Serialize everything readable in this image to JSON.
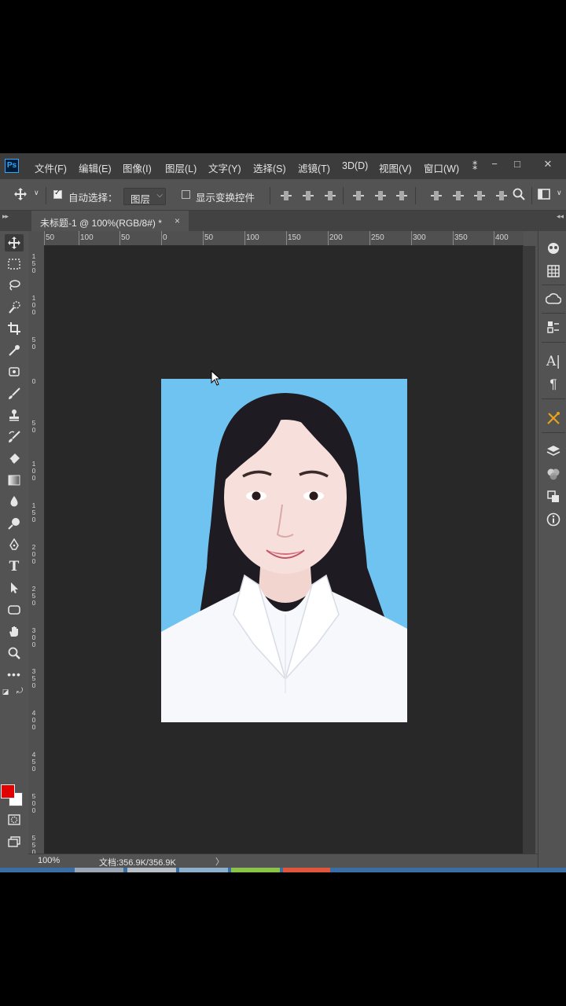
{
  "app": {
    "logo": "Ps",
    "menu": [
      "文件(F)",
      "编辑(E)",
      "图像(I)",
      "图层(L)",
      "文字(Y)",
      "选择(S)",
      "滤镜(T)",
      "3D(D)",
      "视图(V)",
      "窗口(W)"
    ],
    "menu_overflow": "⁑",
    "window_controls": {
      "minimize": "−",
      "restore": "□",
      "close": "✕"
    }
  },
  "options_bar": {
    "auto_select_checked": true,
    "auto_select_label": "自动选择：",
    "target_value": "图层",
    "show_transform_checked": false,
    "show_transform_label": "显示变换控件"
  },
  "document": {
    "tab_title": "未标题-1 @ 100%(RGB/8#) *",
    "tab_close": "×"
  },
  "ruler": {
    "top_labels": [
      "50",
      "100",
      "50",
      "0",
      "50",
      "100",
      "150",
      "200",
      "250",
      "300",
      "350",
      "400"
    ],
    "left_labels": [
      "150",
      "100",
      "50",
      "0",
      "50",
      "100",
      "150",
      "200",
      "250",
      "300",
      "350",
      "400",
      "450",
      "500",
      "550"
    ]
  },
  "status": {
    "zoom": "100%",
    "doc_size": "文档:356.9K/356.9K",
    "arrow": "〉"
  },
  "colors": {
    "foreground": "#e00000",
    "background": "#ffffff",
    "photo_backdrop": "#6ec3f0",
    "canvas": "#282828"
  },
  "tools": [
    "move-icon",
    "marquee-icon",
    "lasso-icon",
    "quick-select-icon",
    "crop-icon",
    "eyedropper-icon",
    "patch-icon",
    "brush-icon",
    "stamp-icon",
    "history-brush-icon",
    "eraser-icon",
    "gradient-icon",
    "blur-icon",
    "dodge-icon",
    "pen-icon",
    "type-icon",
    "path-select-icon",
    "shape-icon",
    "hand-icon",
    "zoom-icon",
    "more-tools-icon"
  ]
}
